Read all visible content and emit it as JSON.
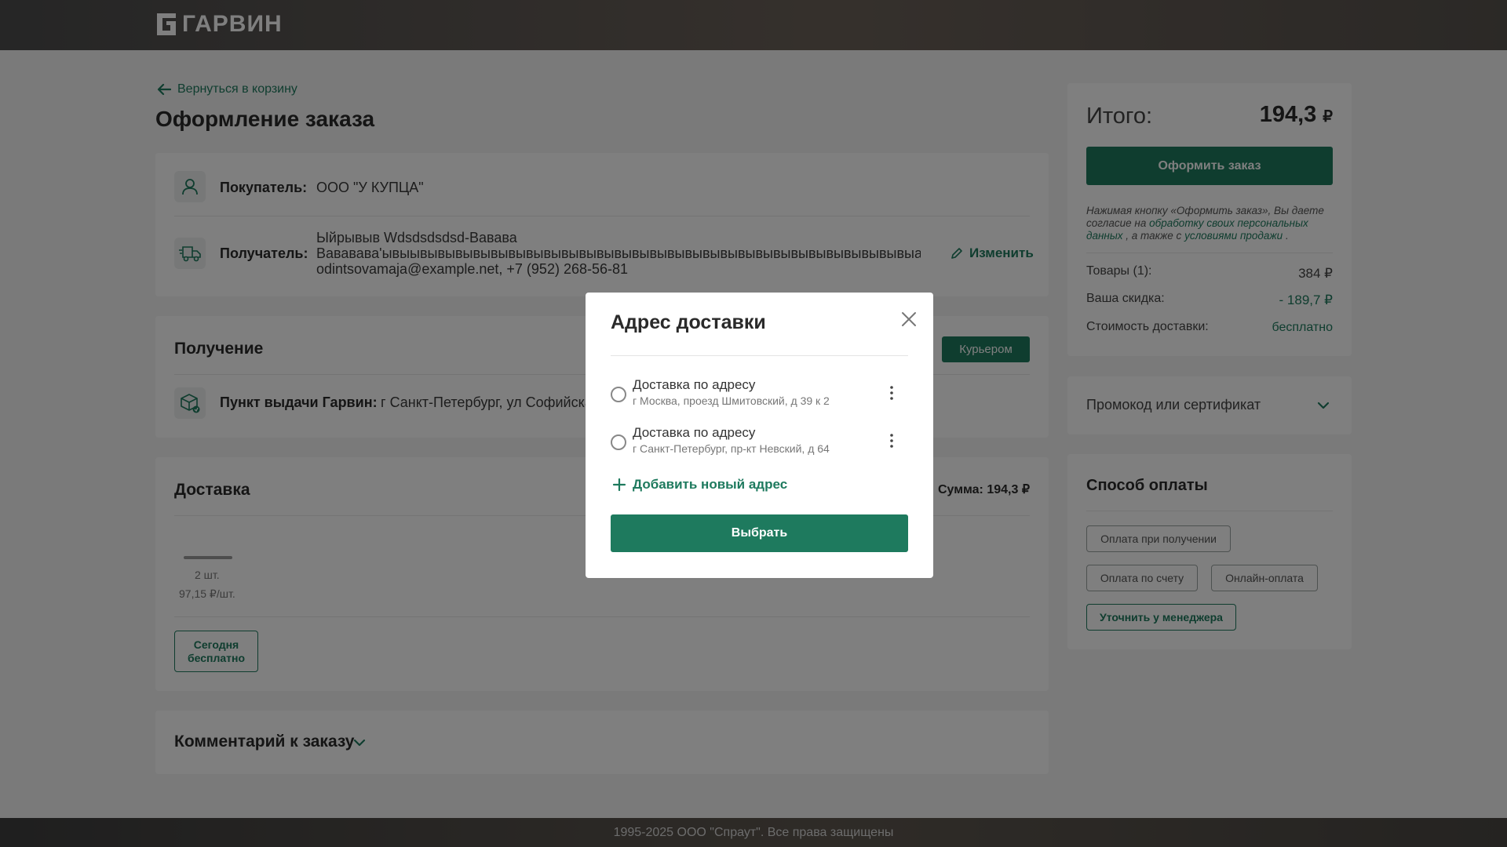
{
  "header": {
    "brand": "ГАРВИН"
  },
  "main": {
    "back_link": "Вернуться в корзину",
    "title": "Оформление заказа"
  },
  "buyer": {
    "label": "Покупатель:",
    "value": "ООО \"У КУПЦА\""
  },
  "recipient": {
    "label": "Получатель:",
    "line1": "Ыйрывыв Wdsdsdsdsd-Вавава",
    "line2": "Вававава'ывыывывывывывывывывывывывывывывывывывывывывывывывывывывывывыаывывывывв,",
    "line3": "odintsovamaja@example.net, +7 (952) 268-56-81",
    "edit": "Изменить"
  },
  "receiving": {
    "title": "Получение",
    "courier_tab": "Курьером",
    "pickup_label": "Пункт выдачи Гарвин:",
    "pickup_value": "г Санкт-Петербург, ул Софийская"
  },
  "delivery": {
    "title": "Доставка",
    "sum": "Сумма: 194,3 ₽",
    "qty": "2 шт.",
    "price_per_unit": "97,15 ₽/шт.",
    "today_line1": "Сегодня",
    "today_line2": "бесплатно"
  },
  "comment": {
    "title": "Комментарий к заказу"
  },
  "summary": {
    "total_label": "Итого:",
    "total_value": "194,3",
    "currency": "₽",
    "order_button": "Оформить заказ",
    "consent_1": "Нажимая кнопку «Оформить заказ», Вы даете согласие на ",
    "consent_link1": "обработку своих персональных данных",
    "consent_2": " , а также с ",
    "consent_link2": "условиями продажи",
    "consent_3": " .",
    "goods_label": "Товары (1):",
    "goods_value": "384 ₽",
    "discount_label": "Ваша скидка:",
    "discount_value": "- 189,7 ₽",
    "shipping_label": "Стоимость доставки:",
    "shipping_value": "бесплатно"
  },
  "promo": {
    "label": "Промокод или сертификат"
  },
  "payment": {
    "title": "Способ оплаты",
    "options": [
      "Оплата при получении",
      "Оплата по счету",
      "Онлайн-оплата",
      "Уточнить у менеджера"
    ]
  },
  "footer": {
    "text": "1995-2025 ООО \"Спраут\". Все права защищены"
  },
  "modal": {
    "title": "Адрес доставки",
    "addresses": [
      {
        "title": "Доставка по адресу",
        "address": "г Москва, проезд Шмитовский, д 39 к 2"
      },
      {
        "title": "Доставка по адресу",
        "address": "г Санкт-Петербург, пр-кт Невский, д 64"
      }
    ],
    "add_new": "Добавить новый адрес",
    "select_button": "Выбрать"
  },
  "colors": {
    "accent": "#1e7a5e",
    "background": "#f4f5f5"
  }
}
